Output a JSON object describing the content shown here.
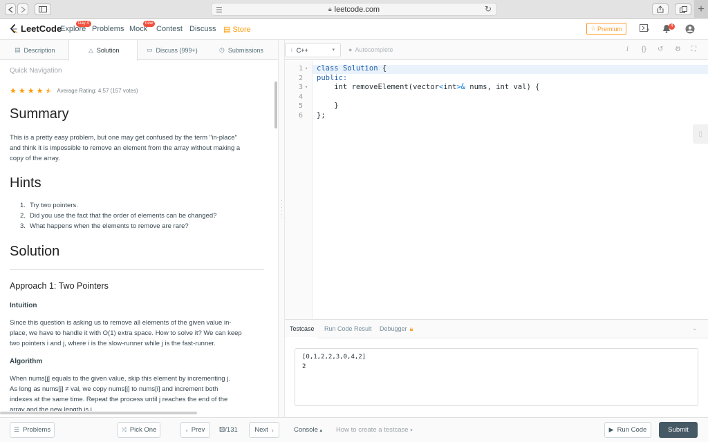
{
  "browser": {
    "url": "leetcode.com"
  },
  "nav": {
    "logo_text": "LeetCode",
    "links": [
      {
        "label": "Explore",
        "badge": "Day 4"
      },
      {
        "label": "Problems",
        "badge": ""
      },
      {
        "label": "Mock",
        "badge": "new"
      },
      {
        "label": "Contest",
        "badge": ""
      },
      {
        "label": "Discuss",
        "badge": ""
      },
      {
        "label": "Store",
        "badge": ""
      }
    ],
    "premium_label": "Premium",
    "notification_count": "4"
  },
  "left_tabs": [
    {
      "label": "Description",
      "icon": "doc-icon"
    },
    {
      "label": "Solution",
      "icon": "flask-icon"
    },
    {
      "label": "Discuss (999+)",
      "icon": "comment-icon"
    },
    {
      "label": "Submissions",
      "icon": "clock-icon"
    }
  ],
  "solution": {
    "quick_nav": "Quick Navigation",
    "rating_text": "Average Rating: 4.57 (157 votes)",
    "rating_value": 4.57,
    "summary_heading": "Summary",
    "summary_lines": [
      "This is a pretty easy problem, but one may get confused by the term \"in-place\"",
      "and think it is impossible to remove an element from the array without making a",
      "copy of the array."
    ],
    "hints_heading": "Hints",
    "hints": [
      {
        "num": "1.",
        "text": "Try two pointers."
      },
      {
        "num": "2.",
        "text": "Did you use the fact that the order of elements can be changed?"
      },
      {
        "num": "3.",
        "text": "What happens when the elements to remove are rare?"
      }
    ],
    "solution_heading": "Solution",
    "approach_heading": "Approach 1: Two Pointers",
    "intuition_heading": "Intuition",
    "intuition_lines": [
      "Since this question is asking us to remove all elements of the given value in-",
      "place, we have to handle it with O(1) extra space. How to solve it? We can keep",
      "two pointers i and j, where i is the slow-runner while j is the fast-runner."
    ],
    "algorithm_heading": "Algorithm",
    "algorithm_lines": [
      "When nums[j] equals to the given value, skip this element by incrementing j.",
      "As long as nums[j] ≠ val, we copy nums[j] to nums[i] and increment both",
      "indexes at the same time. Repeat the process until j reaches the end of the",
      "array and the new length is i."
    ]
  },
  "editor": {
    "language": "C++",
    "autocomplete": "Autocomplete",
    "lines": [
      {
        "num": "1",
        "fold": true
      },
      {
        "num": "2",
        "fold": false
      },
      {
        "num": "3",
        "fold": true
      },
      {
        "num": "4",
        "fold": false
      },
      {
        "num": "5",
        "fold": false
      },
      {
        "num": "6",
        "fold": false
      }
    ],
    "code": {
      "l1_kw": "class",
      "l1_name": "Solution",
      "l1_rest": " {",
      "l2": "public:",
      "l3_a": "    int removeElement(vector",
      "l3_b": "<",
      "l3_c": "int",
      "l3_d": ">&",
      "l3_e": " nums, int val) {",
      "l5": "    }",
      "l6": "};"
    }
  },
  "testcase": {
    "tabs": [
      "Testcase",
      "Run Code Result",
      "Debugger"
    ],
    "input_line1": "[0,1,2,2,3,0,4,2]",
    "input_line2": "2"
  },
  "bottom": {
    "problems": "Problems",
    "pick_one": "Pick One",
    "prev": "Prev",
    "page": "/131",
    "next": "Next",
    "console": "Console",
    "how_to": "How to create a testcase",
    "run_code": "Run Code",
    "submit": "Submit"
  },
  "colors": {
    "accent_orange": "#ff9900",
    "submit_bg": "#455a64",
    "badge_red": "#f0513f"
  }
}
